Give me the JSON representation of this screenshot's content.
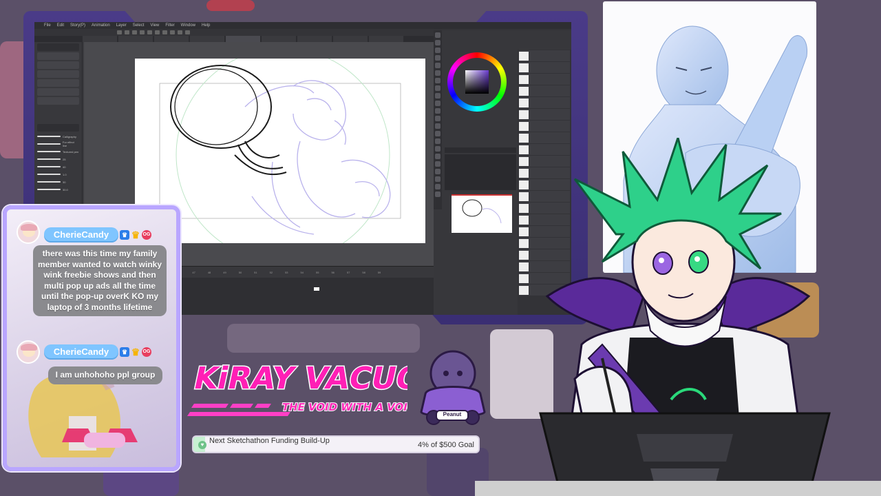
{
  "app": {
    "menu": [
      "File",
      "Edit",
      "Story(P)",
      "Animation",
      "Layer",
      "Select",
      "View",
      "Filter",
      "Window",
      "Help"
    ],
    "brushes": [
      "Calligraphy",
      "For effect line",
      "Textured pen",
      "25",
      "40",
      "1.0",
      "30",
      "30.0"
    ],
    "timeline_ticks": [
      "48",
      "45",
      "46",
      "47",
      "48",
      "49",
      "50",
      "51",
      "52",
      "53",
      "54",
      "55",
      "56",
      "57",
      "58",
      "59"
    ]
  },
  "chat": {
    "messages": [
      {
        "username": "CherieCandy",
        "og_badge": "OG",
        "text": "there was this time my family member wanted to watch winky wink freebie shows and then multi pop up ads all the time until the pop-up overK KO my laptop of 3 months lifetime"
      },
      {
        "username": "CherieCandy",
        "og_badge": "OG",
        "text": "I am unhohoho ppl group"
      }
    ]
  },
  "logo": {
    "mascot_tag": "Peanut"
  },
  "goal": {
    "label": "Next Sketchathon Funding Build-Up",
    "amount": "4% of $500 Goal",
    "percent": 4
  },
  "colors": {
    "accent_pink": "#ff1fb5",
    "frame_purple": "#4a3b88",
    "chat_username": "#7fc5ff",
    "goal_fill": "#c7f0d2"
  }
}
